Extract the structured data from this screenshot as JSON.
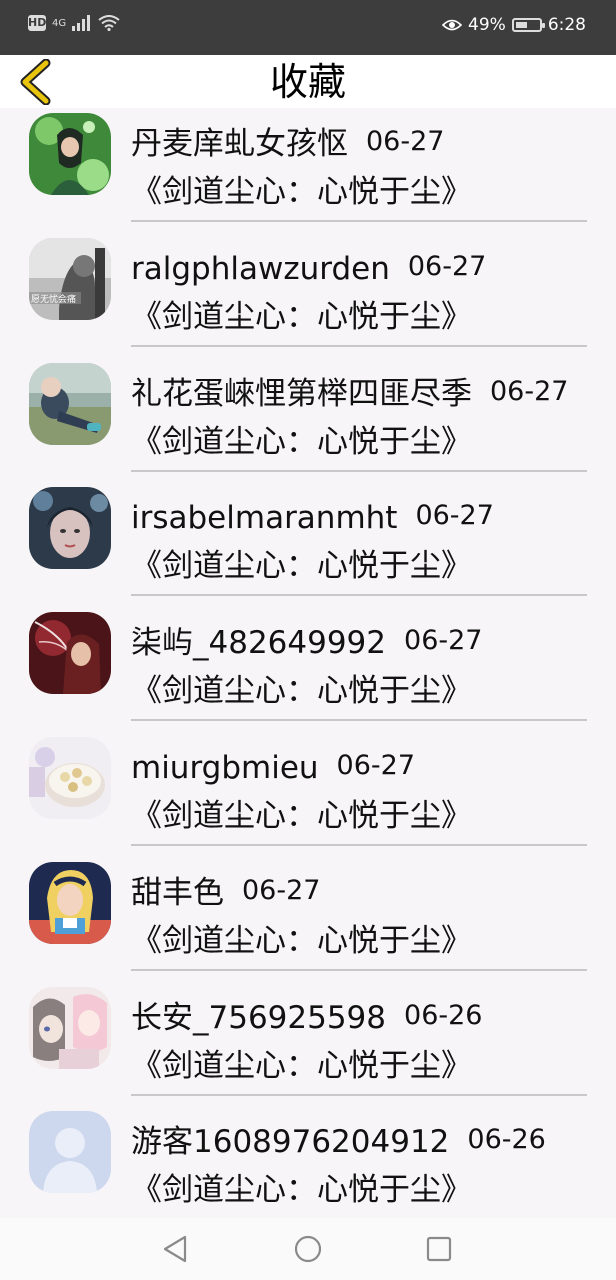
{
  "status_bar": {
    "network": "4G",
    "battery_text": "49%",
    "battery_level": 0.49,
    "time": "6:28"
  },
  "header": {
    "title": "收藏",
    "back_icon": "chevron-left-icon",
    "accent_color": "#e8c40c"
  },
  "favorites": [
    {
      "user": "丹麦庠虬女孩怄",
      "date": "06-27",
      "book": "《剑道尘心：心悦于尘》"
    },
    {
      "user": "ralgphlawzurden",
      "date": "06-27",
      "book": "《剑道尘心：心悦于尘》",
      "avatar_caption": "愿无忧会痛"
    },
    {
      "user": "礼花蛋崍悝第榉四匪尽季",
      "date": "06-27",
      "book": "《剑道尘心：心悦于尘》"
    },
    {
      "user": "irsabelmaranmht",
      "date": "06-27",
      "book": "《剑道尘心：心悦于尘》"
    },
    {
      "user": "柒屿_482649992",
      "date": "06-27",
      "book": "《剑道尘心：心悦于尘》"
    },
    {
      "user": "miurgbmieu",
      "date": "06-27",
      "book": "《剑道尘心：心悦于尘》"
    },
    {
      "user": "甜丰色",
      "date": "06-27",
      "book": "《剑道尘心：心悦于尘》"
    },
    {
      "user": "长安_756925598",
      "date": "06-26",
      "book": "《剑道尘心：心悦于尘》"
    },
    {
      "user": "游客1608976204912",
      "date": "06-26",
      "book": "《剑道尘心：心悦于尘》"
    }
  ],
  "nav": {
    "back_icon": "triangle-back-icon",
    "home_icon": "circle-home-icon",
    "recents_icon": "square-recents-icon"
  }
}
